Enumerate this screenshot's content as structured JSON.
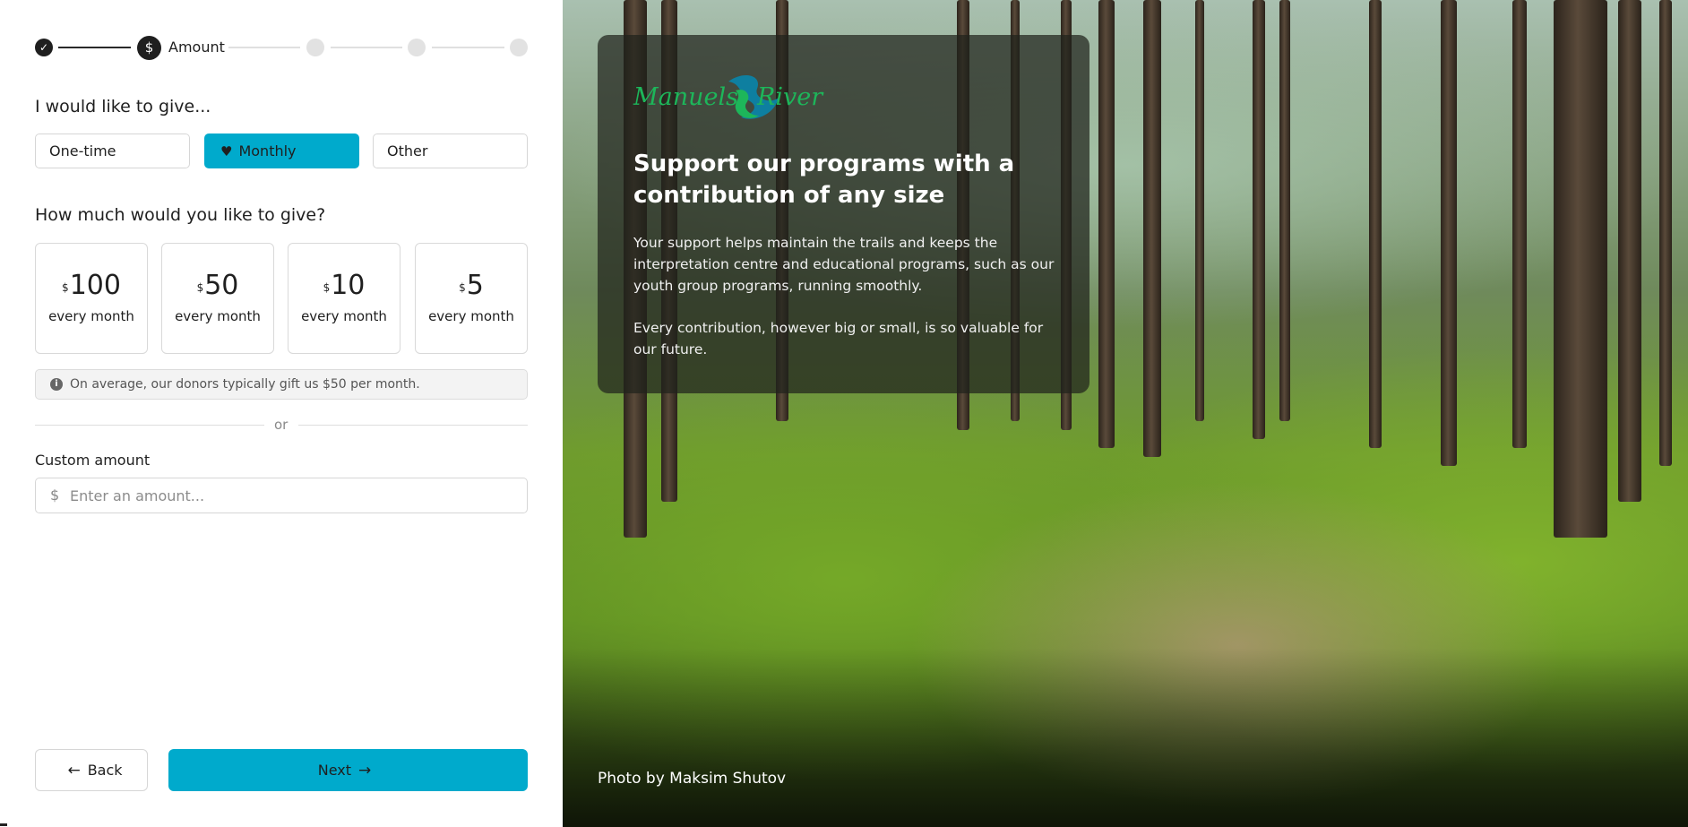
{
  "stepper": {
    "steps": [
      {
        "state": "done",
        "icon": "check-icon"
      },
      {
        "state": "current",
        "label": "Amount",
        "icon": "dollar-icon"
      },
      {
        "state": "upcoming"
      },
      {
        "state": "upcoming"
      },
      {
        "state": "upcoming"
      }
    ],
    "current_label": "Amount"
  },
  "frequency": {
    "heading": "I would like to give...",
    "options": [
      "One-time",
      "Monthly",
      "Other"
    ],
    "selected": "Monthly"
  },
  "amounts": {
    "heading": "How much would you like to give?",
    "currency_symbol": "$",
    "cards": [
      {
        "value": "100",
        "period": "every month"
      },
      {
        "value": "50",
        "period": "every month"
      },
      {
        "value": "10",
        "period": "every month"
      },
      {
        "value": "5",
        "period": "every month"
      }
    ]
  },
  "info_note": "On average, our donors typically gift us $50 per month.",
  "divider_text": "or",
  "custom": {
    "label": "Custom amount",
    "currency_symbol": "$",
    "placeholder": "Enter an amount...",
    "value": ""
  },
  "nav": {
    "back_label": "Back",
    "next_label": "Next"
  },
  "hero": {
    "logo_text_left": "Manuels",
    "logo_text_right": "River",
    "title": "Support our programs with a contribution of any size",
    "paragraph1": "Your support helps maintain the trails and keeps the interpretation centre and educational programs, such as our youth group programs, running smoothly.",
    "paragraph2": "Every contribution, however big or small, is so valuable for our future.",
    "photo_credit": "Photo by Maksim Shutov"
  },
  "colors": {
    "accent": "#00aacc",
    "logo_green": "#1db65a",
    "logo_teal": "#0e7fa0",
    "text": "#1f1f1f"
  }
}
